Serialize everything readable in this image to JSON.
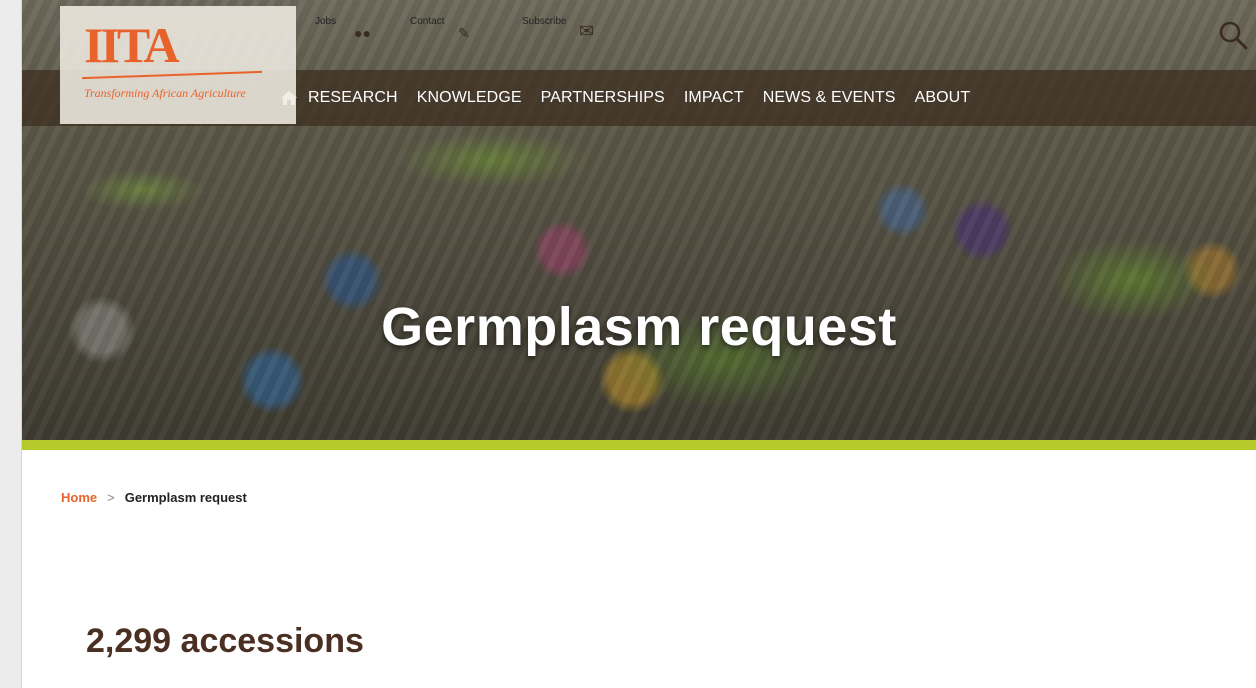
{
  "header": {
    "logo": {
      "text": "IITA",
      "tagline": "Transforming African Agriculture"
    },
    "utility_links": [
      {
        "label": "Jobs",
        "icon": "jobs-icon"
      },
      {
        "label": "Contact",
        "icon": "contact-icon"
      },
      {
        "label": "Subscribe",
        "icon": "envelope-icon"
      }
    ],
    "search_icon": "search-icon"
  },
  "nav": {
    "home_icon": "home-icon",
    "items": [
      "RESEARCH",
      "KNOWLEDGE",
      "PARTNERSHIPS",
      "IMPACT",
      "NEWS & EVENTS",
      "ABOUT"
    ]
  },
  "hero": {
    "title": "Germplasm request"
  },
  "breadcrumb": {
    "home": "Home",
    "separator": ">",
    "current": "Germplasm request"
  },
  "main": {
    "accessions": "2,299 accessions"
  },
  "colors": {
    "brand_orange": "#e8632b",
    "accent_lime": "#b5c92a",
    "nav_bg": "#3c2d1e",
    "heading_brown": "#4a2f22"
  }
}
